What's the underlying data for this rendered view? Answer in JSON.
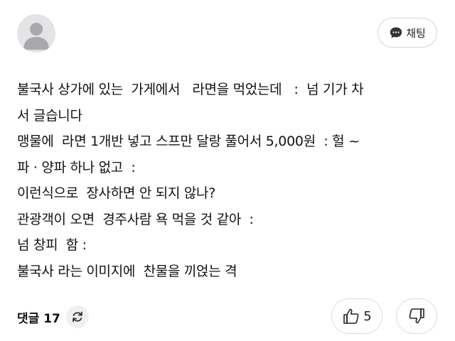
{
  "author": {
    "avatar_icon": "default-user-avatar"
  },
  "chat_button": {
    "label": "채팅",
    "icon": "chat-bubble-icon"
  },
  "post": {
    "lines": [
      "불국사 상가에 있는  가게에서   라면을 먹었는데   :  넘 기가 차",
      "서 글습니다",
      "맹물에  라면 1개반 넣고 스프만 달랑 풀어서 5,000원  : 헐 ~",
      "파 · 양파 하나 없고  :",
      "이런식으로  장사하면 안 되지 않나?",
      "관광객이 오면  경주사람 욕 먹을 것 같아  :",
      "넘 창피  함 :",
      "불국사 라는 이미지에  찬물을 끼얹는 격"
    ]
  },
  "footer": {
    "comments_label": "댓글 17",
    "refresh_icon": "refresh-icon",
    "like_count": "5",
    "like_icon": "thumbs-up-icon",
    "dislike_icon": "thumbs-down-icon"
  },
  "colors": {
    "avatar_bg": "#e4e4e6",
    "avatar_fg": "#a9a9ad",
    "border": "#d4d4d8",
    "text": "#111111"
  }
}
